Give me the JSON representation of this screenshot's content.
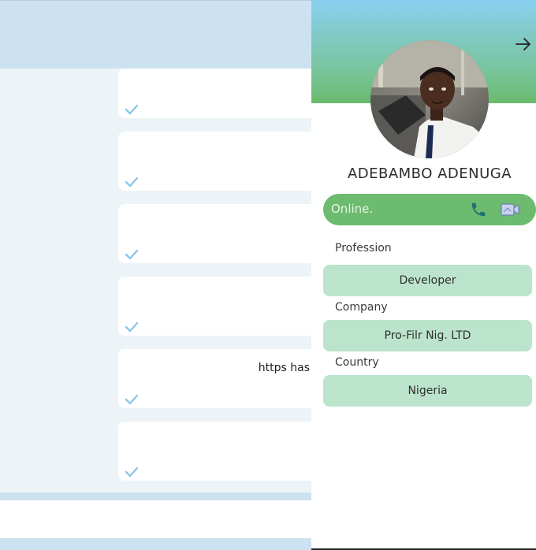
{
  "chat": {
    "messages": [
      {
        "text": ""
      },
      {
        "text": ""
      },
      {
        "text": ""
      },
      {
        "text": ""
      },
      {
        "text": "https has"
      },
      {
        "text": ""
      }
    ]
  },
  "profile": {
    "name": "ADEBAMBO ADENUGA",
    "status": "Online.",
    "fields": {
      "profession_label": "Profession",
      "profession_value": "Developer",
      "company_label": "Company",
      "company_value": "Pro-Filr Nig. LTD",
      "country_label": "Country",
      "country_value": "Nigeria"
    }
  },
  "colors": {
    "banner_top": "#8ad0f0",
    "banner_bottom": "#6aba6c",
    "status_bar": "#6cbb6e",
    "field_box": "#bce4cd",
    "chat_bg": "#edf4f8",
    "chat_header": "#cde2f1",
    "check": "#8cc6ea"
  },
  "icons": {
    "close": "arrow-right-icon",
    "call": "phone-icon",
    "video": "video-camera-icon",
    "read": "checkmark-icon"
  }
}
